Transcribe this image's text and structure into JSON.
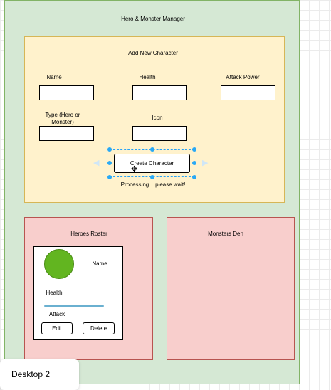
{
  "manager": {
    "title": "Hero & Monster Manager"
  },
  "add_character": {
    "title": "Add New Character",
    "fields": {
      "name": {
        "label": "Name",
        "value": ""
      },
      "health": {
        "label": "Health",
        "value": ""
      },
      "attack_power": {
        "label": "Attack Power",
        "value": ""
      },
      "type": {
        "label": "Type (Hero or Monster)",
        "value": ""
      },
      "icon": {
        "label": "Icon",
        "value": ""
      }
    },
    "create_button": "Create Character",
    "status": "Processing... please wait!"
  },
  "heroes": {
    "title": "Heroes Roster",
    "card": {
      "name_label": "Name",
      "health_label": "Health",
      "attack_label": "Attack",
      "edit_button": "Edit",
      "delete_button": "Delete"
    }
  },
  "monsters": {
    "title": "Monsters Den"
  },
  "canvas": {
    "page_label": "Desktop 2"
  },
  "colors": {
    "manager_fill": "#d5e8d4",
    "form_fill": "#fff2cc",
    "roster_fill": "#f8cecc",
    "avatar_fill": "#62b520",
    "selection": "#29a9f5"
  }
}
